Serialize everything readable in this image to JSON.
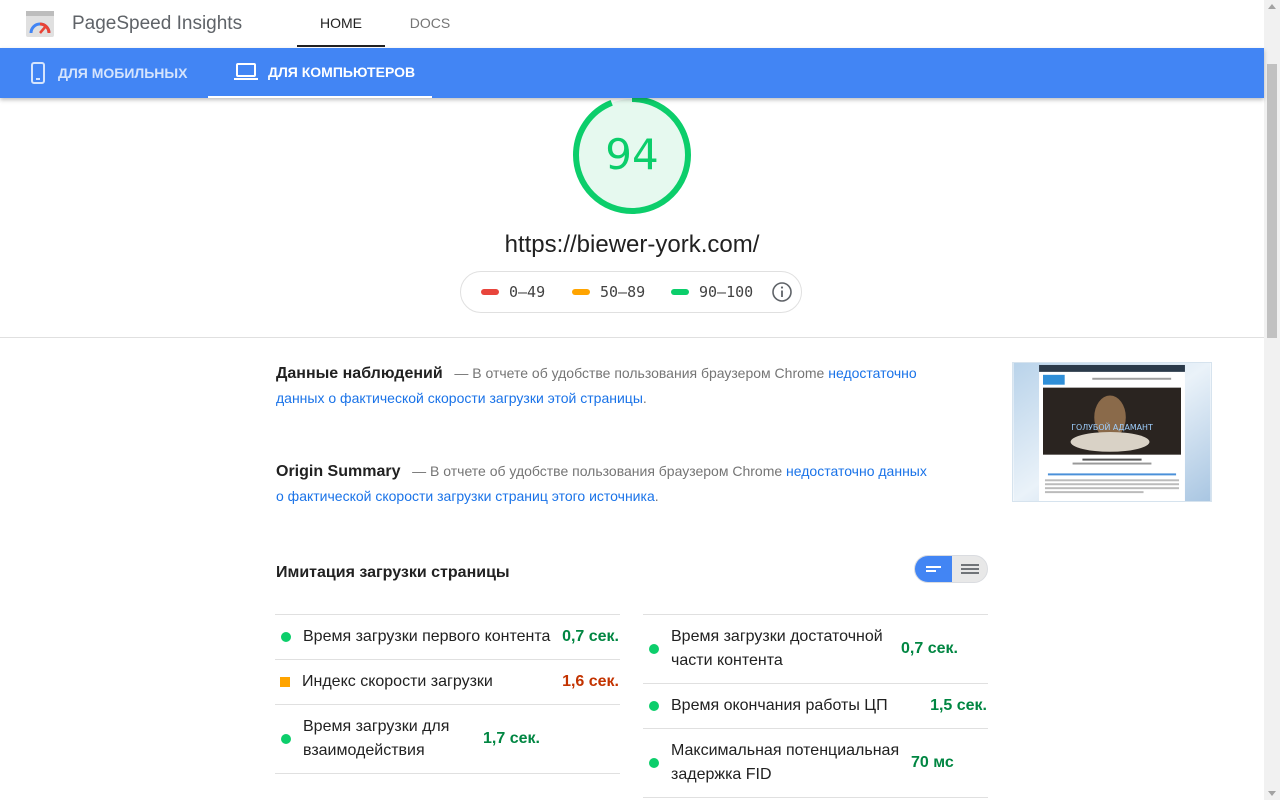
{
  "app": {
    "title": "PageSpeed Insights"
  },
  "nav": {
    "home": "HOME",
    "docs": "DOCS"
  },
  "device_tabs": {
    "mobile": "ДЛЯ МОБИЛЬНЫХ",
    "desktop": "ДЛЯ КОМПЬЮТЕРОВ",
    "active": "desktop"
  },
  "score": {
    "value": "94",
    "status": "good",
    "fraction": 0.94
  },
  "url": "https://biewer-york.com/",
  "legend": [
    {
      "range": "0–49",
      "color": "#e8453c"
    },
    {
      "range": "50–89",
      "color": "#ffa400"
    },
    {
      "range": "90–100",
      "color": "#0cce6b"
    }
  ],
  "field_data": {
    "title": "Данные наблюдений",
    "text": "— В отчете об удобстве пользования браузером Chrome ",
    "link": "недостаточно данных о фактической скорости загрузки этой страницы",
    "end": "."
  },
  "origin_summary": {
    "title": "Origin Summary",
    "text": "— В отчете об удобстве пользования браузером Chrome ",
    "link": "недостаточно данных о фактической скорости загрузки страниц этого источника",
    "end": "."
  },
  "screenshot_text": "ГОЛУБОЙ АДАМАНТ",
  "lab": {
    "title": "Имитация загрузки страницы",
    "left": [
      {
        "name": "Время загрузки первого контента",
        "value": "0,7 сек.",
        "status": "good"
      },
      {
        "name": "Индекс скорости загрузки",
        "value": "1,6 сек.",
        "status": "average"
      },
      {
        "name": "Время загрузки для взаимодействия",
        "value": "1,7 сек.",
        "status": "good"
      }
    ],
    "right": [
      {
        "name": "Время загрузки достаточной части контента",
        "value": "0,7 сек.",
        "status": "good"
      },
      {
        "name": "Время окончания работы ЦП",
        "value": "1,5 сек.",
        "status": "good"
      },
      {
        "name": "Максимальная потенциальная задержка FID",
        "value": "70 мс",
        "status": "good"
      }
    ]
  },
  "colors": {
    "accent": "#4285f4",
    "good": "#0cce6b",
    "average": "#ffa400",
    "poor": "#e8453c",
    "link": "#1a73e8"
  }
}
